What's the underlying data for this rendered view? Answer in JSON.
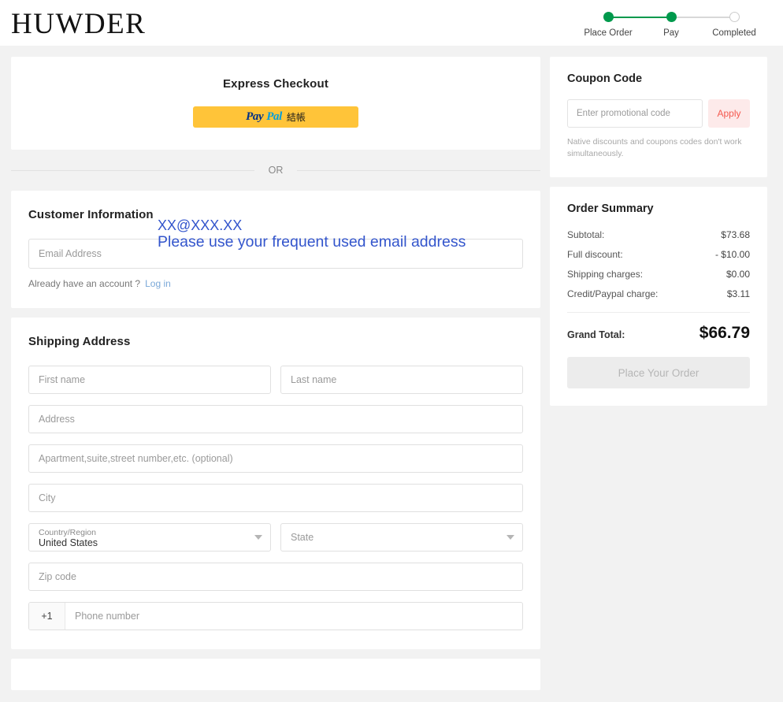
{
  "header": {
    "brand": "HUWDER",
    "stepper": [
      {
        "label": "Place Order",
        "state": "done"
      },
      {
        "label": "Pay",
        "state": "done"
      },
      {
        "label": "Completed",
        "state": "pending"
      }
    ]
  },
  "express": {
    "title": "Express Checkout",
    "paypal": {
      "pay": "Pay",
      "pal": "Pal",
      "suffix": "結帳"
    }
  },
  "divider": {
    "or": "OR"
  },
  "customer": {
    "title": "Customer Information",
    "email_placeholder": "Email Address",
    "email_value": "",
    "account_question": "Already have an account ?",
    "login_label": "Log in",
    "annotation_line1": "XX@XXX.XX",
    "annotation_line2": "Please use your frequent used email address"
  },
  "shipping": {
    "title": "Shipping Address",
    "first_name_placeholder": "First name",
    "last_name_placeholder": "Last name",
    "address_placeholder": "Address",
    "apartment_placeholder": "Apartment,suite,street number,etc. (optional)",
    "city_placeholder": "City",
    "country_label": "Country/Region",
    "country_value": "United States",
    "state_placeholder": "State",
    "zip_placeholder": "Zip code",
    "phone_prefix": "+1",
    "phone_placeholder": "Phone number"
  },
  "coupon": {
    "title": "Coupon Code",
    "input_placeholder": "Enter promotional code",
    "input_value": "",
    "apply_label": "Apply",
    "note": "Native discounts and coupons codes don't work simultaneously."
  },
  "order_summary": {
    "title": "Order Summary",
    "rows": [
      {
        "label": "Subtotal:",
        "value": "$73.68"
      },
      {
        "label": "Full discount:",
        "value": "- $10.00"
      },
      {
        "label": "Shipping charges:",
        "value": "$0.00"
      },
      {
        "label": "Credit/Paypal charge:",
        "value": "$3.11"
      }
    ],
    "grand_label": "Grand Total:",
    "grand_value": "$66.79",
    "place_order_label": "Place Your Order"
  },
  "colors": {
    "page_bg": "#f2f2f2",
    "step_done": "#00994c",
    "step_pending": "#cccccc",
    "paypal_bg": "#ffc439",
    "apply_bg": "#fdeaea",
    "apply_text": "#f4594f",
    "annotation": "#3355cc",
    "link": "#7aa8d8"
  }
}
